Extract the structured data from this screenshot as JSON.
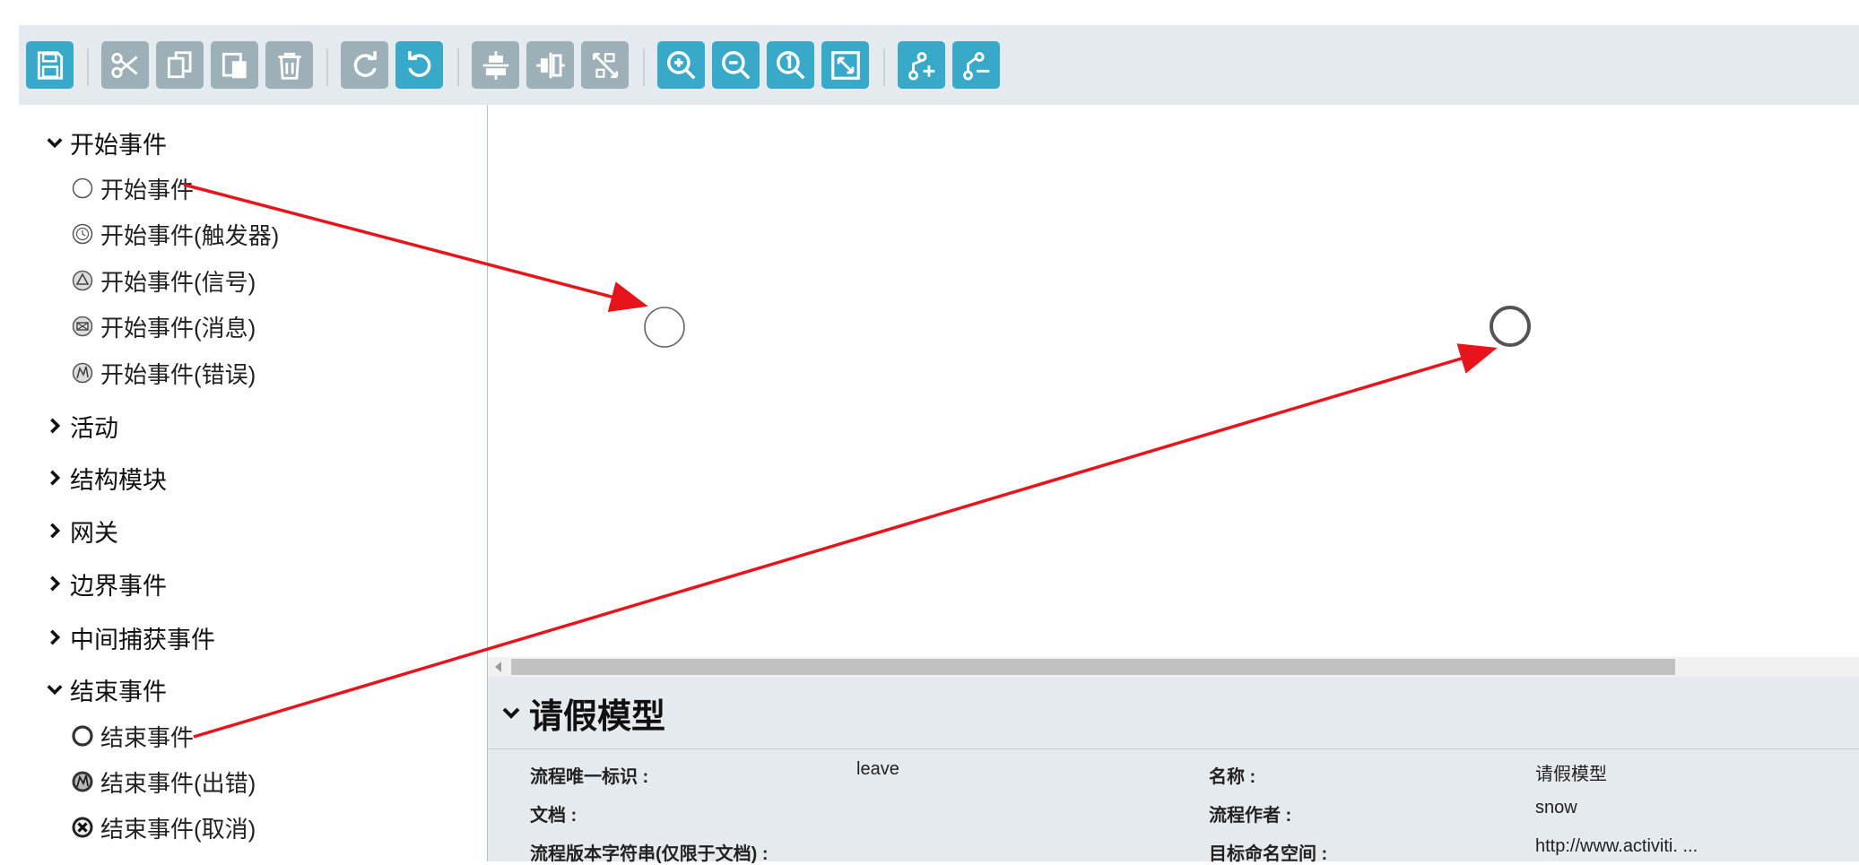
{
  "palette": {
    "start_group": {
      "label": "开始事件",
      "expanded": true
    },
    "start_items": [
      {
        "label": "开始事件",
        "icon": "start-none-event-icon"
      },
      {
        "label": "开始事件(触发器)",
        "icon": "start-timer-event-icon"
      },
      {
        "label": "开始事件(信号)",
        "icon": "start-signal-event-icon"
      },
      {
        "label": "开始事件(消息)",
        "icon": "start-message-event-icon"
      },
      {
        "label": "开始事件(错误)",
        "icon": "start-error-event-icon"
      }
    ],
    "groups": [
      "活动",
      "结构模块",
      "网关",
      "边界事件",
      "中间捕获事件"
    ],
    "end_group": {
      "label": "结束事件",
      "expanded": true
    },
    "end_items": [
      {
        "label": "结束事件",
        "icon": "end-none-event-icon"
      },
      {
        "label": "结束事件(出错)",
        "icon": "end-error-event-icon"
      },
      {
        "label": "结束事件(取消)",
        "icon": "end-cancel-event-icon"
      }
    ]
  },
  "toolbar": {
    "icons": [
      "save-icon",
      "cut-icon",
      "copy-icon",
      "paste-icon",
      "delete-icon",
      "redo-icon",
      "undo-icon",
      "align-horizontal-icon",
      "align-vertical-icon",
      "same-size-icon",
      "zoom-in-icon",
      "zoom-out-icon",
      "zoom-actual-icon",
      "zoom-fit-icon",
      "add-bendpoint-icon",
      "remove-bendpoint-icon"
    ]
  },
  "properties": {
    "title": "请假模型",
    "fields": {
      "process_id": {
        "label": "流程唯一标识 :",
        "value": "leave"
      },
      "name": {
        "label": "名称 :",
        "value": "请假模型"
      },
      "documentation": {
        "label": "文档 :",
        "value": ""
      },
      "author": {
        "label": "流程作者 :",
        "value": "snow"
      },
      "version": {
        "label": "流程版本字符串(仅限于文档) :",
        "value": ""
      },
      "namespace": {
        "label": "目标命名空间 :",
        "value": "http://www.activiti. ..."
      }
    }
  },
  "colors": {
    "toolbar_bg": "#e5eaee",
    "button_active": "#38a9c8",
    "button_disabled": "#9dafb7",
    "annotation_arrow": "#e8141b"
  }
}
